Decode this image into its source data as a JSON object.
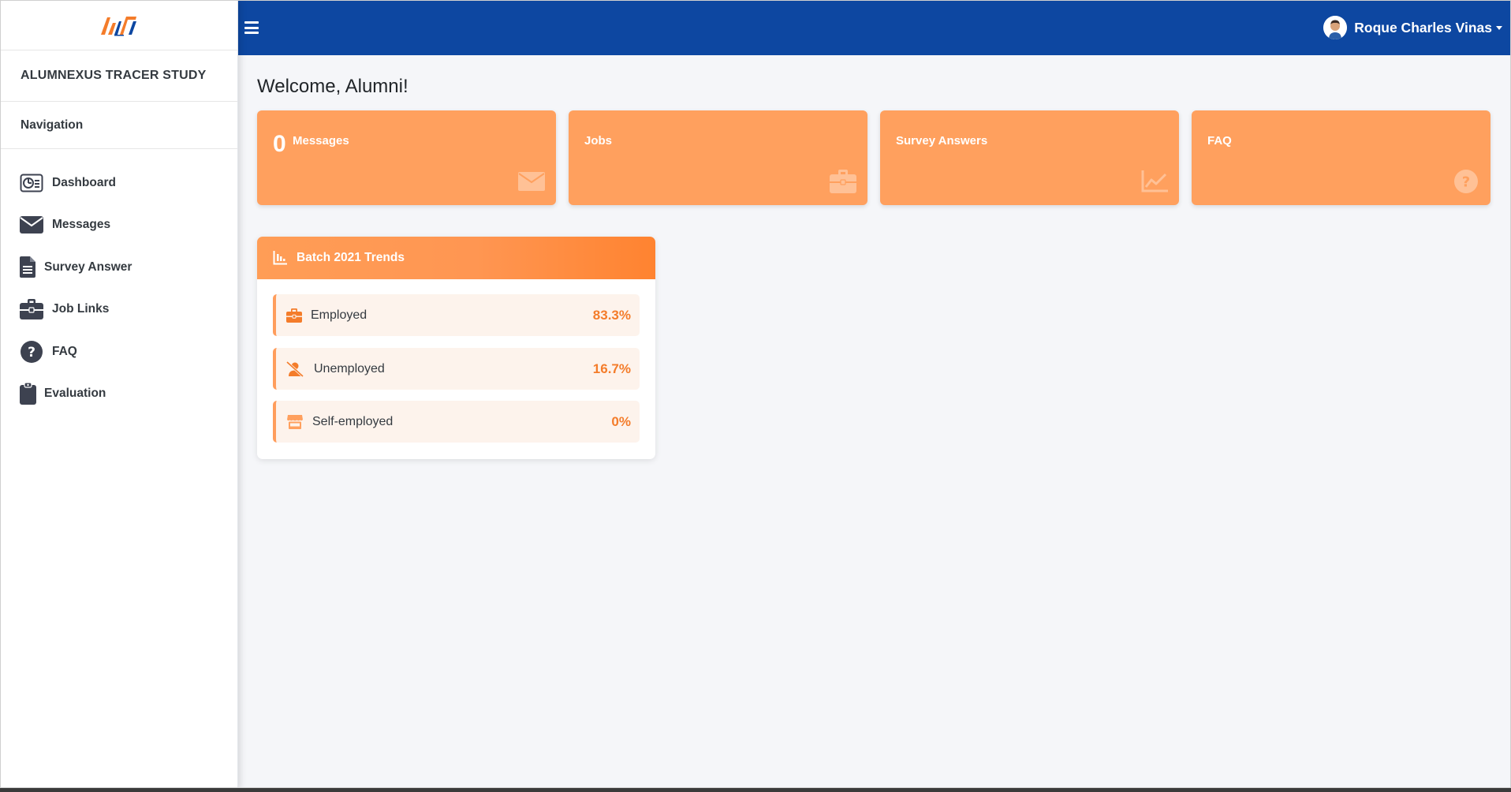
{
  "sidebar": {
    "brand": "ALUMNEXUS TRACER STUDY",
    "nav_header": "Navigation",
    "items": [
      {
        "label": "Dashboard",
        "icon": "dashboard-icon"
      },
      {
        "label": "Messages",
        "icon": "envelope-icon"
      },
      {
        "label": "Survey Answer",
        "icon": "file-icon"
      },
      {
        "label": "Job Links",
        "icon": "briefcase-icon"
      },
      {
        "label": "FAQ",
        "icon": "question-icon"
      },
      {
        "label": "Evaluation",
        "icon": "clipboard-icon"
      }
    ]
  },
  "topbar": {
    "user_name": "Roque Charles Vinas"
  },
  "main": {
    "welcome": "Welcome, Alumni!",
    "cards": [
      {
        "count": "0",
        "label": "Messages",
        "icon": "envelope-icon"
      },
      {
        "label": "Jobs",
        "icon": "briefcase-icon"
      },
      {
        "label": "Survey Answers",
        "icon": "chart-line-icon"
      },
      {
        "label": "FAQ",
        "icon": "question-icon"
      }
    ],
    "trends": {
      "title": "Batch 2021 Trends",
      "rows": [
        {
          "label": "Employed",
          "value": "83.3%",
          "icon": "briefcase-icon"
        },
        {
          "label": "Unemployed",
          "value": "16.7%",
          "icon": "user-slash-icon"
        },
        {
          "label": "Self-employed",
          "value": "0%",
          "icon": "store-icon"
        }
      ]
    }
  },
  "colors": {
    "topbar": "#0d47a1",
    "card": "#ffa05e",
    "accent": "#f47c2a",
    "row_bg": "#fdf3ec"
  }
}
